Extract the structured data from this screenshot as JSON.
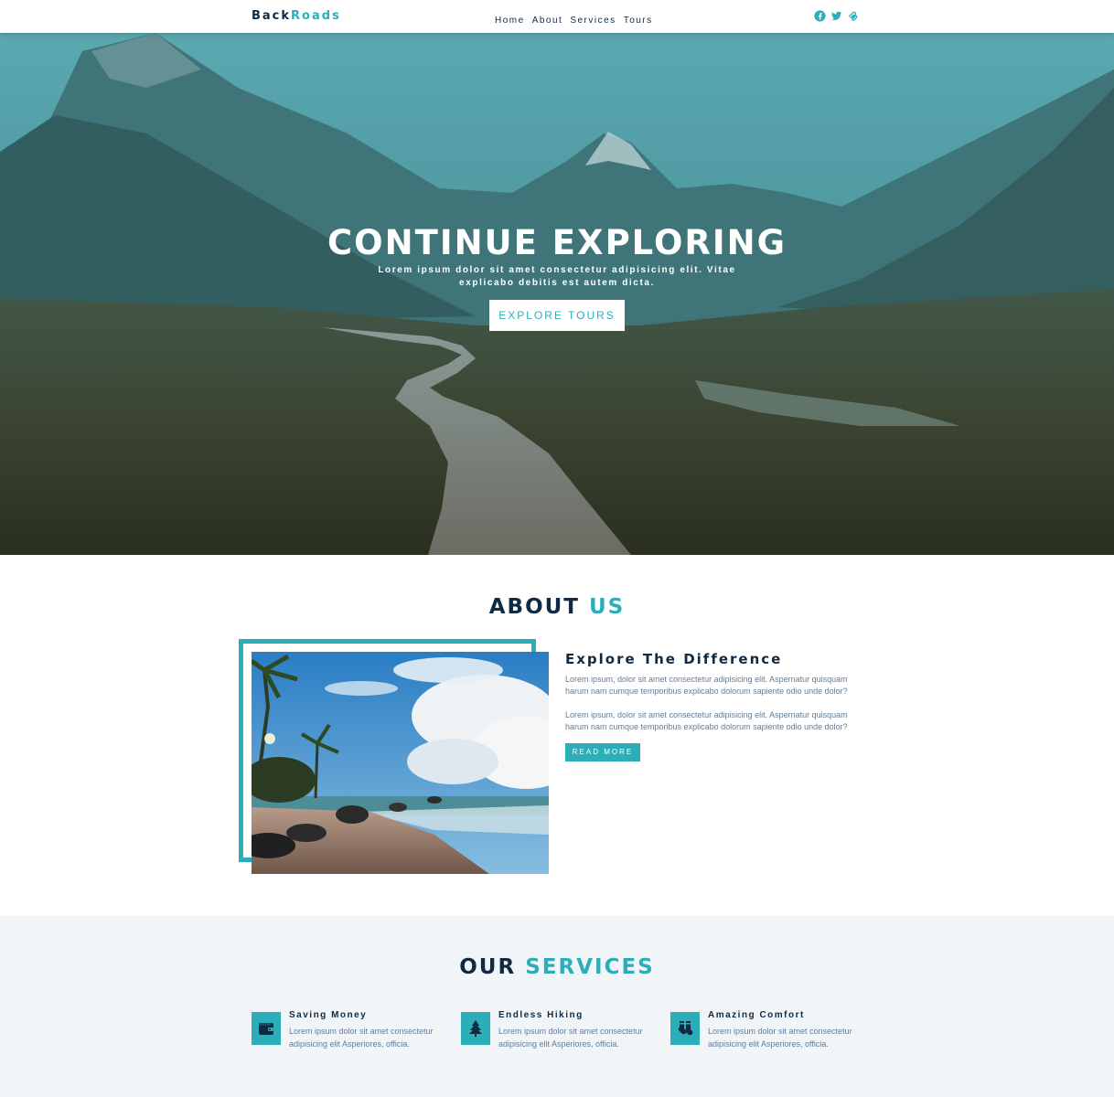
{
  "navbar": {
    "logo_part1": "Back",
    "logo_part2": "Roads",
    "links": [
      "Home",
      "About",
      "Services",
      "Tours"
    ],
    "social_icons": [
      "facebook-icon",
      "twitter-icon",
      "squarespace-icon"
    ]
  },
  "hero": {
    "title": "CONTINUE EXPLORING",
    "text": "Lorem ipsum dolor sit amet consectetur adipisicing elit. Vitae explicabo debitis est autem dicta.",
    "button": "EXPLORE TOURS"
  },
  "about": {
    "title_part1": "ABOUT",
    "title_part2": "US",
    "heading": "Explore The Difference",
    "paragraph1": "Lorem ipsum, dolor sit amet consectetur adipisicing elit. Aspernatur quisquam harum nam cumque temporibus explicabo dolorum sapiente odio unde dolor?",
    "paragraph2": "Lorem ipsum, dolor sit amet consectetur adipisicing elit. Aspernatur quisquam harum nam cumque temporibus explicabo dolorum sapiente odio unde dolor?",
    "button": "READ MORE"
  },
  "services": {
    "title_part1": "OUR",
    "title_part2": "SERVICES",
    "items": [
      {
        "title": "Saving Money",
        "text": "Lorem ipsum dolor sit amet consectetur adipisicing elit Asperiores, officia.",
        "icon": "wallet-icon"
      },
      {
        "title": "Endless Hiking",
        "text": "Lorem ipsum dolor sit amet consectetur adipisicing elit Asperiores, officia.",
        "icon": "tree-icon"
      },
      {
        "title": "Amazing Comfort",
        "text": "Lorem ipsum dolor sit amet consectetur adipisicing elit Asperiores, officia.",
        "icon": "socks-icon"
      }
    ]
  },
  "colors": {
    "accent": "#2caeba",
    "dark": "#102a42",
    "muted": "#617d98",
    "section_bg": "#f1f5f8"
  }
}
